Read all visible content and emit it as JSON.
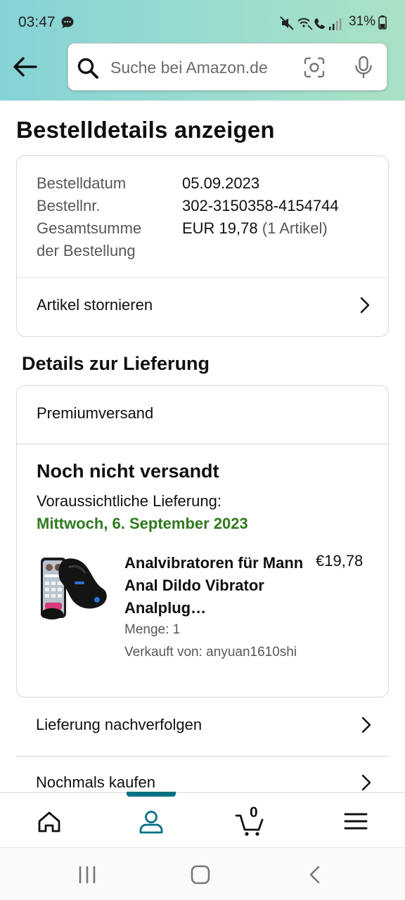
{
  "status_bar": {
    "time": "03:47",
    "battery": "31%"
  },
  "search": {
    "placeholder": "Suche bei Amazon.de"
  },
  "page": {
    "title": "Bestelldetails anzeigen"
  },
  "order": {
    "date_label": "Bestelldatum",
    "date_value": "05.09.2023",
    "number_label": "Bestellnr.",
    "number_value": "302-3150358-4154744",
    "total_label_line1": "Gesamtsumme",
    "total_label_line2": "der Bestellung",
    "total_value": "EUR 19,78",
    "total_items": "(1 Artikel)",
    "cancel_label": "Artikel stornieren"
  },
  "delivery": {
    "heading": "Details zur Lieferung",
    "shipping_speed": "Premiumversand",
    "status": "Noch nicht versandt",
    "expected_label": "Voraussichtliche Lieferung:",
    "expected_date": "Mittwoch, 6. September 2023",
    "accent_color": "#2f7a1f"
  },
  "product": {
    "title": "Analvibratoren für Mann Anal Dildo Vibrator Analplug…",
    "price": "€19,78",
    "quantity": "Menge: 1",
    "seller": "Verkauft von: anyuan1610shi"
  },
  "actions": {
    "track": "Lieferung nachverfolgen",
    "buy_again": "Nochmals kaufen"
  },
  "bottom_nav": {
    "items": [
      "home-icon",
      "account-icon",
      "cart-icon",
      "menu-icon"
    ],
    "cart_count": "0",
    "active_color": "#007185"
  }
}
